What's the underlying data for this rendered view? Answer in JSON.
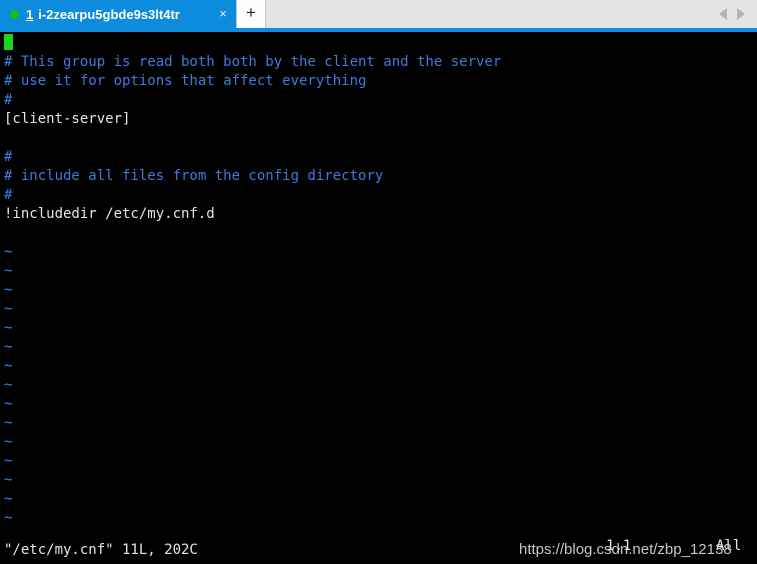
{
  "tabbar": {
    "status_dot": "connected",
    "tab_index": "1",
    "tab_title": "i-2zearpu5gbde9s3lt4tr",
    "close_label": "×",
    "new_tab_label": "+",
    "nav_prev": "prev",
    "nav_next": "next",
    "accent_color": "#0d8bdc",
    "bar_background": "#e4e4e4"
  },
  "terminal": {
    "background": "#000000",
    "cursor_color": "#18d718",
    "comment_color": "#3b7ddd",
    "text_color": "#e6e6e6",
    "tilde_color": "#2f8fe8",
    "lines": [
      {
        "kind": "cursor",
        "text": ""
      },
      {
        "kind": "comment",
        "text": "# This group is read both both by the client and the server"
      },
      {
        "kind": "comment",
        "text": "# use it for options that affect everything"
      },
      {
        "kind": "comment",
        "text": "#"
      },
      {
        "kind": "text",
        "text": "[client-server]"
      },
      {
        "kind": "text",
        "text": ""
      },
      {
        "kind": "comment",
        "text": "#"
      },
      {
        "kind": "comment",
        "text": "# include all files from the config directory"
      },
      {
        "kind": "comment",
        "text": "#"
      },
      {
        "kind": "text",
        "text": "!includedir /etc/my.cnf.d"
      },
      {
        "kind": "text",
        "text": ""
      },
      {
        "kind": "tilde",
        "text": "~"
      },
      {
        "kind": "tilde",
        "text": "~"
      },
      {
        "kind": "tilde",
        "text": "~"
      },
      {
        "kind": "tilde",
        "text": "~"
      },
      {
        "kind": "tilde",
        "text": "~"
      },
      {
        "kind": "tilde",
        "text": "~"
      },
      {
        "kind": "tilde",
        "text": "~"
      },
      {
        "kind": "tilde",
        "text": "~"
      },
      {
        "kind": "tilde",
        "text": "~"
      },
      {
        "kind": "tilde",
        "text": "~"
      },
      {
        "kind": "tilde",
        "text": "~"
      },
      {
        "kind": "tilde",
        "text": "~"
      },
      {
        "kind": "tilde",
        "text": "~"
      },
      {
        "kind": "tilde",
        "text": "~"
      },
      {
        "kind": "tilde",
        "text": "~"
      }
    ]
  },
  "statusline": {
    "file_info": "\"/etc/my.cnf\" 11L, 202C",
    "cursor_position": "1,1",
    "scroll_position": "All"
  },
  "watermark": {
    "url": "https://blog.csdn.net/zbp_12138"
  }
}
